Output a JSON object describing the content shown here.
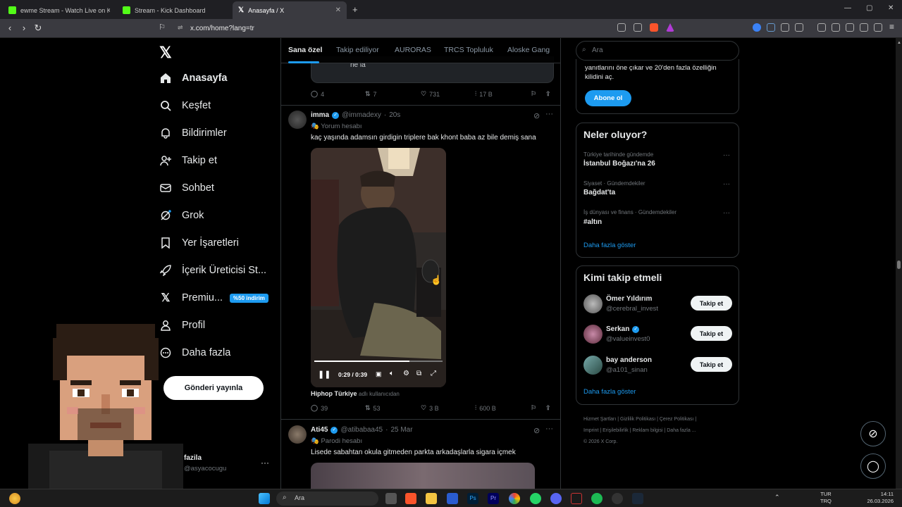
{
  "browser": {
    "tabs": [
      {
        "title": "ewme Stream - Watch Live on Ki",
        "color": "#53fc18"
      },
      {
        "title": "Stream - Kick Dashboard",
        "color": "#53fc18"
      },
      {
        "title": "Anasayfa / X",
        "color": "#ffffff"
      }
    ],
    "url": "x.com/home?lang=tr"
  },
  "nav": {
    "items": [
      {
        "label": "Anasayfa",
        "icon": "home-icon"
      },
      {
        "label": "Keşfet",
        "icon": "search-icon"
      },
      {
        "label": "Bildirimler",
        "icon": "bell-icon"
      },
      {
        "label": "Takip et",
        "icon": "add-user-icon"
      },
      {
        "label": "Sohbet",
        "icon": "mail-icon"
      },
      {
        "label": "Grok",
        "icon": "grok-icon"
      },
      {
        "label": "Yer İşaretleri",
        "icon": "bookmark-icon"
      },
      {
        "label": "İçerik Üreticisi St...",
        "icon": "rocket-icon"
      },
      {
        "label": "Premiu...",
        "icon": "x-icon"
      },
      {
        "label": "Profil",
        "icon": "person-icon"
      },
      {
        "label": "Daha fazla",
        "icon": "more-icon"
      }
    ],
    "premium_badge": "%50 indirim",
    "post_button": "Gönderi yayınla",
    "account": {
      "name": "fazila",
      "handle": "@asyacocugu"
    }
  },
  "feed": {
    "tabs": [
      "Sana özel",
      "Takip ediliyor",
      "AURORAS",
      "TRCS Topluluk",
      "Aloske Gang"
    ],
    "prev_snippet": "ne la",
    "prev_actions": {
      "replies": "4",
      "reposts": "7",
      "likes": "731",
      "views": "17 B"
    },
    "tweet1": {
      "name": "imma",
      "handle": "@immadexy",
      "time": "20s",
      "tag": "Yorum hesabı",
      "text": "kaç yaşında adamsın girdigin triplere bak khont baba az bile demiş sana",
      "video_time": "0:29 / 0:39",
      "video_progress": 0.74,
      "source_name": "Hiphop Türkiye",
      "source_suffix": "adlı kullanıcıdan",
      "actions": {
        "replies": "39",
        "reposts": "53",
        "likes": "3 B",
        "views": "600 B"
      }
    },
    "tweet2": {
      "name": "Ati45",
      "handle": "@atibabaa45",
      "time": "25 Mar",
      "tag": "Parodi hesabı",
      "text": "Lisede sabahtan okula gitmeden parkta arkadaşlarla sigara içmek"
    }
  },
  "sidebar": {
    "search_placeholder": "Ara",
    "premium_text_1": "yanıtlarını öne çıkar ve 20'den fazla özelliğin",
    "premium_text_2": "kilidini aç.",
    "subscribe_button": "Abone ol",
    "trends_title": "Neler oluyor?",
    "trends": [
      {
        "category": "Türkiye tarihinde gündemde",
        "name": "İstanbul Boğazı'na 26"
      },
      {
        "category": "Siyaset · Gündemdekiler",
        "name": "Bağdat'ta"
      },
      {
        "category": "İş dünyası ve finans · Gündemdekiler",
        "name": "#altın"
      }
    ],
    "show_more": "Daha fazla göster",
    "follow_title": "Kimi takip etmeli",
    "follow": [
      {
        "name": "Ömer Yıldırım",
        "handle": "@cerebral_invest",
        "verified": false
      },
      {
        "name": "Serkan",
        "handle": "@valueinvest0",
        "verified": true
      },
      {
        "name": "bay anderson",
        "handle": "@a101_sinan",
        "verified": false
      }
    ],
    "follow_button": "Takip et",
    "footer_line1": "Hizmet Şartları  |  Gizlilik Politikası  |  Çerez Politikası  |",
    "footer_line2": "Imprint  |  Erişilebilirlik  |  Reklam bilgisi  |  Daha fazla ...",
    "footer_line3": "© 2026 X Corp."
  },
  "taskbar": {
    "search_placeholder": "Ara",
    "lang_1": "TUR",
    "lang_2": "TRQ",
    "time": "14:11",
    "date": "26.03.2026"
  }
}
